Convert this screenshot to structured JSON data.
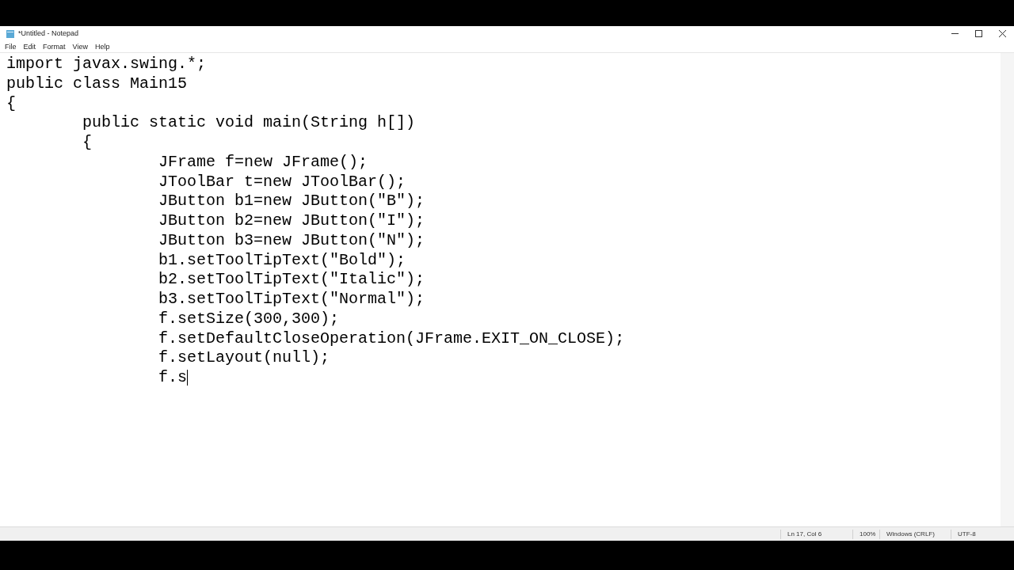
{
  "window": {
    "title": "*Untitled - Notepad"
  },
  "menu": [
    "File",
    "Edit",
    "Format",
    "View",
    "Help"
  ],
  "editor": {
    "lines": [
      "import javax.swing.*;",
      "public class Main15",
      "{",
      "\tpublic static void main(String h[])",
      "\t{",
      "\t\tJFrame f=new JFrame();",
      "\t\tJToolBar t=new JToolBar();",
      "\t\tJButton b1=new JButton(\"B\");",
      "\t\tJButton b2=new JButton(\"I\");",
      "\t\tJButton b3=new JButton(\"N\");",
      "\t\tb1.setToolTipText(\"Bold\");",
      "\t\tb2.setToolTipText(\"Italic\");",
      "\t\tb3.setToolTipText(\"Normal\");",
      "\t\tf.setSize(300,300);",
      "\t\tf.setDefaultCloseOperation(JFrame.EXIT_ON_CLOSE);",
      "\t\tf.setLayout(null);",
      "\t\tf.s"
    ]
  },
  "status_bar": [
    "Ln 17, Col 6",
    "100%",
    "Windows (CRLF)",
    "UTF-8"
  ]
}
